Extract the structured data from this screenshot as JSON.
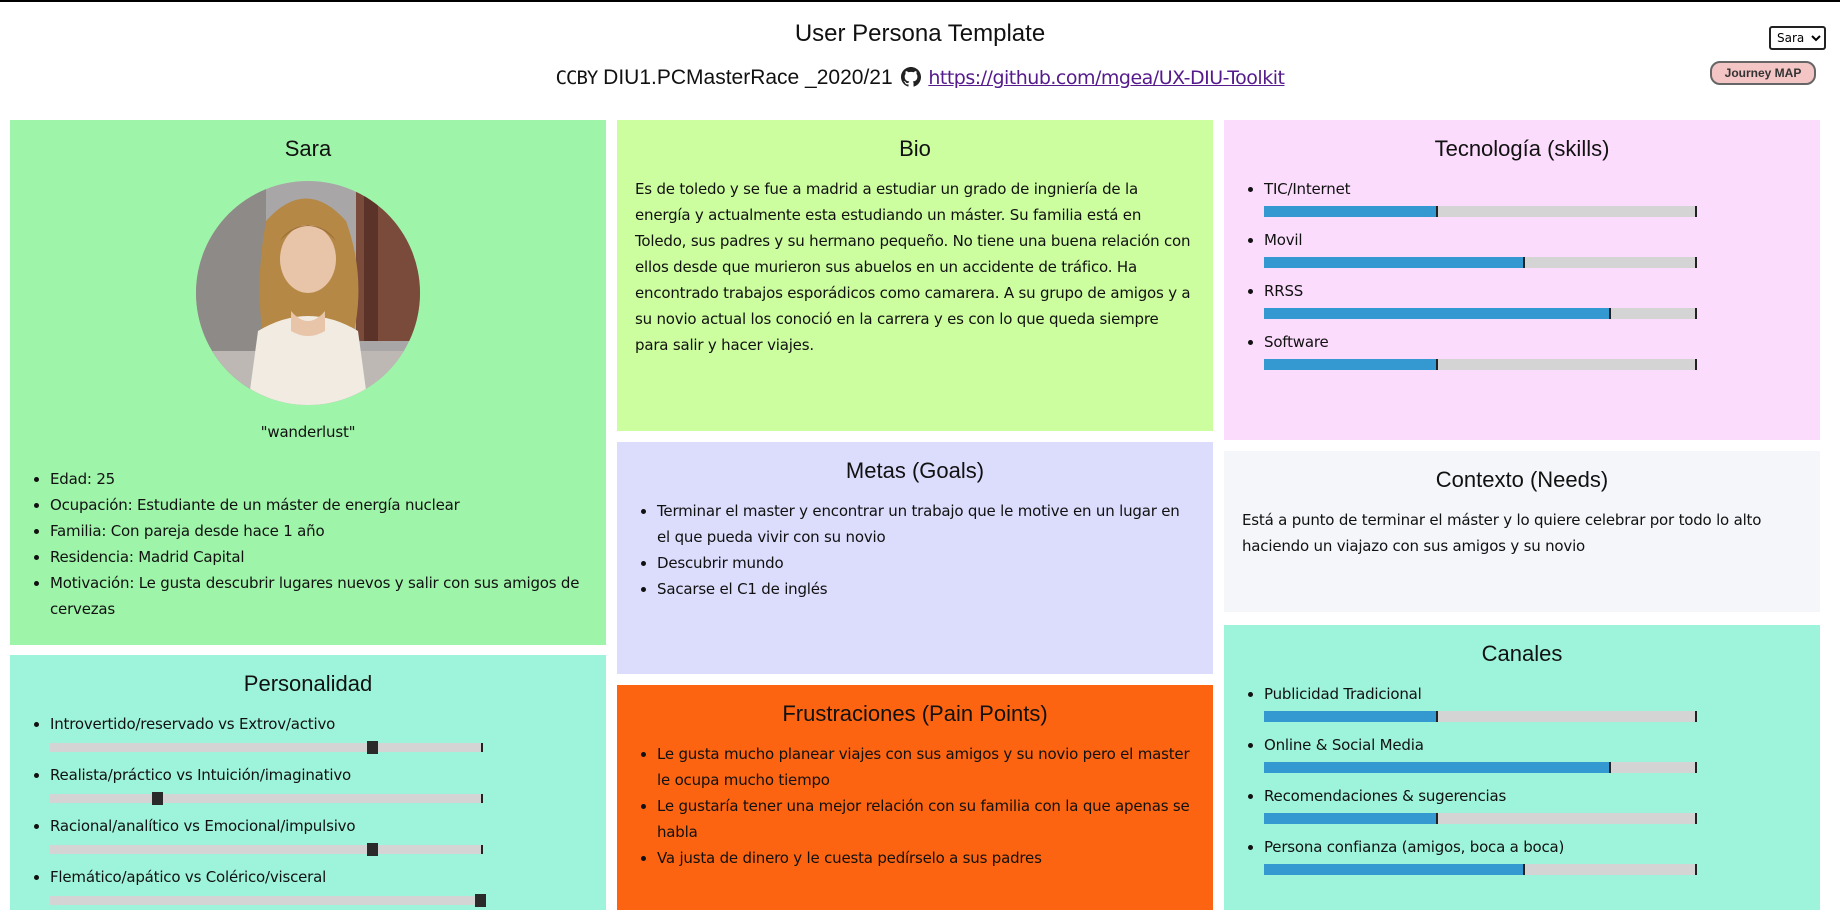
{
  "header": {
    "title": "User Persona Template",
    "cc_text": "CCBY",
    "project": "DIU1.PCMasterRace _2020/21",
    "link": "https://github.com/mgea/UX-DIU-Toolkit"
  },
  "controls": {
    "persona_selected": "Sara",
    "journey_button": "Journey MAP"
  },
  "profile": {
    "name": "Sara",
    "quote": "\"wanderlust\"",
    "details": [
      "Edad: 25",
      "Ocupación: Estudiante de un máster de energía nuclear",
      "Familia: Con pareja desde hace 1 año",
      "Residencia: Madrid Capital",
      "Motivación: Le gusta descubrir lugares nuevos y salir con sus amigos de cervezas"
    ]
  },
  "bio": {
    "title": "Bio",
    "text": "Es de toledo y se fue a madrid a estudiar un grado de ingniería de la energía y actualmente esta estudiando un máster. Su familia está en Toledo, sus padres y su hermano pequeño. No tiene una buena relación con ellos desde que murieron sus abuelos en un accidente de tráfico. Ha encontrado trabajos esporádicos como camarera. A su grupo de amigos y a su novio actual los conoció en la carrera y es con lo que queda siempre para salir y hacer viajes."
  },
  "goals": {
    "title": "Metas (Goals)",
    "items": [
      "Terminar el master y encontrar un trabajo que le motive en un lugar en el que pueda vivir con su novio",
      "Descubrir mundo",
      "Sacarse el C1 de inglés"
    ]
  },
  "frustrations": {
    "title": "Frustraciones (Pain Points)",
    "items": [
      "Le gusta mucho planear viajes con sus amigos y su novio pero el master le ocupa mucho tiempo",
      "Le gustaría tener una mejor relación con su familia con la que apenas se habla",
      "Va justa de dinero y le cuesta pedírselo a sus padres"
    ]
  },
  "personality": {
    "title": "Personalidad",
    "items": [
      {
        "label": "Introvertido/reservado vs Extrov/activo",
        "value": 0.75
      },
      {
        "label": "Realista/práctico vs Intuición/imaginativo",
        "value": 0.25
      },
      {
        "label": "Racional/analítico vs Emocional/impulsivo",
        "value": 0.75
      },
      {
        "label": "Flemático/apático vs Colérico/visceral",
        "value": 1.0
      }
    ]
  },
  "skills": {
    "title": "Tecnología (skills)",
    "items": [
      {
        "label": "TIC/Internet",
        "value": 0.4
      },
      {
        "label": "Movil",
        "value": 0.6
      },
      {
        "label": "RRSS",
        "value": 0.8
      },
      {
        "label": "Software",
        "value": 0.4
      }
    ]
  },
  "context": {
    "title": "Contexto (Needs)",
    "text": "Está a punto de terminar el máster y lo quiere celebrar por todo lo alto haciendo un viajazo con sus amigos y su novio"
  },
  "channels": {
    "title": "Canales",
    "items": [
      {
        "label": "Publicidad Tradicional",
        "value": 0.4
      },
      {
        "label": "Online & Social Media",
        "value": 0.8
      },
      {
        "label": "Recomendaciones & sugerencias",
        "value": 0.4
      },
      {
        "label": "Persona confianza (amigos, boca a boca)",
        "value": 0.6
      }
    ]
  },
  "colors": {
    "profile_bg": "#9ef4a8",
    "bio_bg": "#ccfd9e",
    "goals_bg": "#dcdcfd",
    "frustrations_bg": "#fc6411",
    "personality_bg": "#9ef4da",
    "skills_bg": "#fcdcfd",
    "context_bg": "#f4f6fa",
    "channels_bg": "#9ef4da",
    "bar_fill": "#3599d1"
  }
}
